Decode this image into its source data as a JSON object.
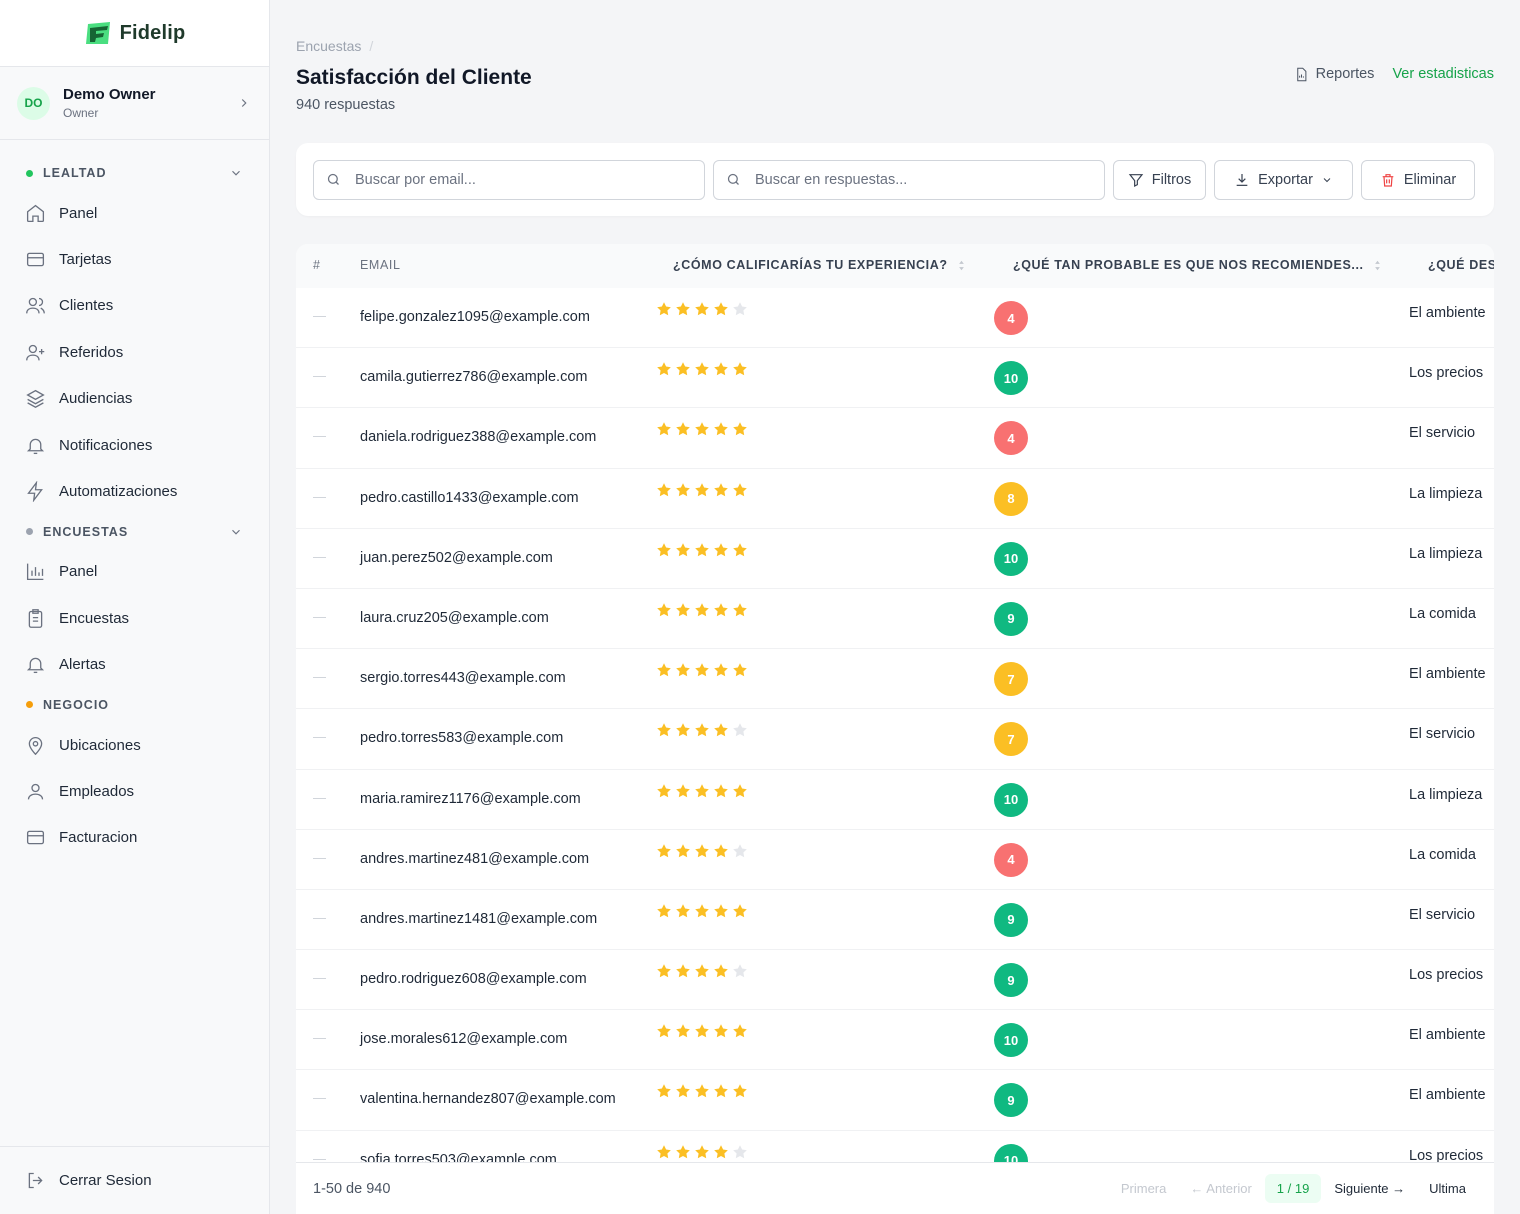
{
  "app": {
    "name": "Fidelip"
  },
  "user": {
    "initials": "DO",
    "name": "Demo Owner",
    "role": "Owner"
  },
  "nav": {
    "sections": [
      {
        "label": "LEALTAD",
        "color": "#22c55e",
        "items": [
          "Panel",
          "Tarjetas",
          "Clientes",
          "Referidos",
          "Audiencias",
          "Notificaciones",
          "Automatizaciones"
        ]
      },
      {
        "label": "ENCUESTAS",
        "color": "#9ca3af",
        "items": [
          "Panel",
          "Encuestas",
          "Alertas"
        ]
      },
      {
        "label": "NEGOCIO",
        "color": "#f59e0b",
        "items": [
          "Ubicaciones",
          "Empleados",
          "Facturacion"
        ]
      }
    ],
    "logout": "Cerrar Sesion"
  },
  "header": {
    "breadcrumb": "Encuestas",
    "breadcrumb_sep": "/",
    "title": "Satisfacción del Cliente",
    "subtitle": "940 respuestas",
    "reports": "Reportes",
    "stats": "Ver estadisticas"
  },
  "toolbar": {
    "search_email": "Buscar por email...",
    "search_answers": "Buscar en respuestas...",
    "filters": "Filtros",
    "export": "Exportar",
    "delete": "Eliminar"
  },
  "table": {
    "columns": [
      "#",
      "EMAIL",
      "¿CÓMO CALIFICARÍAS TU EXPERIENCIA?",
      "¿QUÉ TAN PROBABLE ES QUE NOS RECOMIENDES...",
      "¿QUÉ DES"
    ],
    "rows": [
      {
        "email": "felipe.gonzalez1095@example.com",
        "stars": 4,
        "score": 4,
        "answer": "El ambiente"
      },
      {
        "email": "camila.gutierrez786@example.com",
        "stars": 5,
        "score": 10,
        "answer": "Los precios"
      },
      {
        "email": "daniela.rodriguez388@example.com",
        "stars": 5,
        "score": 4,
        "answer": "El servicio"
      },
      {
        "email": "pedro.castillo1433@example.com",
        "stars": 5,
        "score": 8,
        "answer": "La limpieza"
      },
      {
        "email": "juan.perez502@example.com",
        "stars": 5,
        "score": 10,
        "answer": "La limpieza"
      },
      {
        "email": "laura.cruz205@example.com",
        "stars": 5,
        "score": 9,
        "answer": "La comida"
      },
      {
        "email": "sergio.torres443@example.com",
        "stars": 5,
        "score": 7,
        "answer": "El ambiente"
      },
      {
        "email": "pedro.torres583@example.com",
        "stars": 4,
        "score": 7,
        "answer": "El servicio"
      },
      {
        "email": "maria.ramirez1176@example.com",
        "stars": 5,
        "score": 10,
        "answer": "La limpieza"
      },
      {
        "email": "andres.martinez481@example.com",
        "stars": 4,
        "score": 4,
        "answer": "La comida"
      },
      {
        "email": "andres.martinez1481@example.com",
        "stars": 5,
        "score": 9,
        "answer": "El servicio"
      },
      {
        "email": "pedro.rodriguez608@example.com",
        "stars": 4,
        "score": 9,
        "answer": "Los precios"
      },
      {
        "email": "jose.morales612@example.com",
        "stars": 5,
        "score": 10,
        "answer": "El ambiente"
      },
      {
        "email": "valentina.hernandez807@example.com",
        "stars": 5,
        "score": 9,
        "answer": "El ambiente"
      },
      {
        "email": "sofia.torres503@example.com",
        "stars": 4,
        "score": 10,
        "answer": "Los precios"
      }
    ],
    "colors": {
      "low": "#f87171",
      "mid": "#fbbf24",
      "high": "#10b981",
      "star": "#fbbf24",
      "star_empty": "#e5e7eb"
    }
  },
  "footer": {
    "range": "1-50 de 940",
    "first": "Primera",
    "prev": "← Anterior",
    "page": "1 / 19",
    "next": "Siguiente →",
    "last": "Ultima"
  }
}
